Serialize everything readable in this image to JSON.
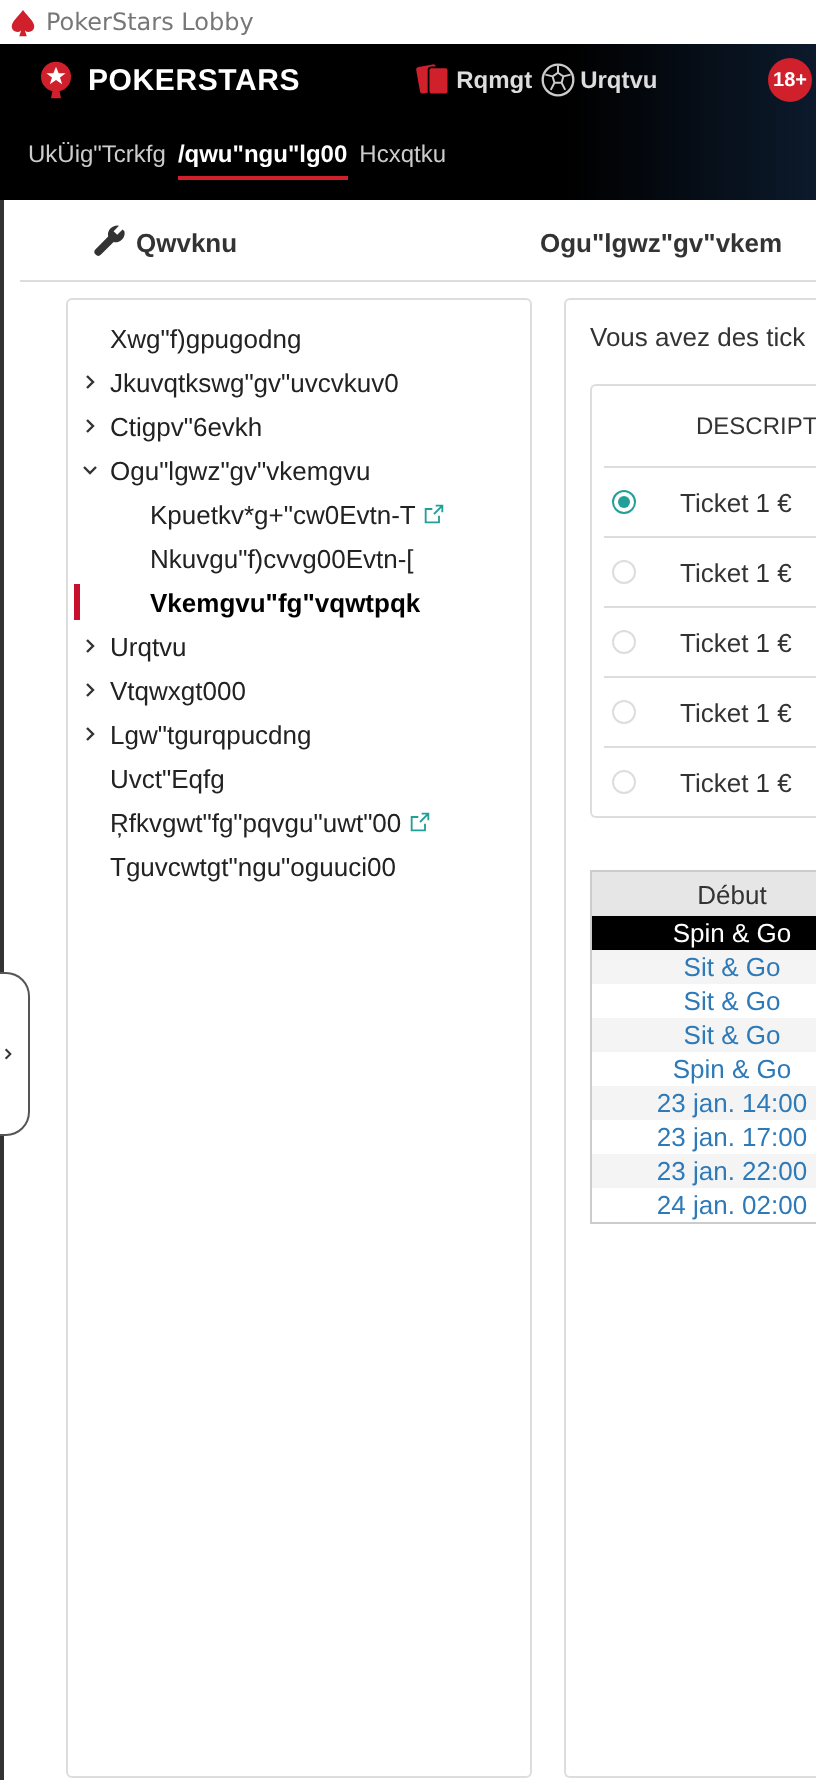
{
  "window": {
    "title": "PokerStars Lobby"
  },
  "header": {
    "brand": "POKERSTARS",
    "links": [
      {
        "label": "Rqmgt",
        "kind": "cards"
      },
      {
        "label": "Urqtvu",
        "kind": "ball"
      }
    ],
    "age_badge": "18+"
  },
  "nav": [
    {
      "label": "UkÜig\"Tcrkfg",
      "selected": false
    },
    {
      "label": "/qwu\"ngu\"lg00",
      "selected": true
    },
    {
      "label": "Hcxqtku",
      "selected": false
    }
  ],
  "sidebar": {
    "title": "Qwvknu",
    "items": [
      {
        "label": "Xwg\"f)gpugodng",
        "kind": "leaf",
        "selected": false,
        "external": false
      },
      {
        "label": "Jkuvqtkswg\"gv\"uvcvkuv0",
        "kind": "folder",
        "expanded": false,
        "selected": false,
        "external": false
      },
      {
        "label": "Ctigpv\"6evkh",
        "kind": "folder",
        "expanded": false,
        "selected": false,
        "external": false
      },
      {
        "label": "Ogu\"lgwz\"gv\"vkemgvu",
        "kind": "folder",
        "expanded": true,
        "selected": false,
        "external": false,
        "children": [
          {
            "label": "Kpuetkv*g+\"cw0Evtn-T",
            "selected": false,
            "external": true
          },
          {
            "label": "Nkuvgu\"f)cvvg00Evtn-[",
            "selected": false,
            "external": false
          },
          {
            "label": "Vkemgvu\"fg\"vqwtpqk",
            "selected": true,
            "external": false
          }
        ]
      },
      {
        "label": "Urqtvu",
        "kind": "folder",
        "expanded": false,
        "selected": false,
        "external": false
      },
      {
        "label": "Vtqwxgt000",
        "kind": "folder",
        "expanded": false,
        "selected": false,
        "external": false
      },
      {
        "label": "Lgw\"tgurqpucdng",
        "kind": "folder",
        "expanded": false,
        "selected": false,
        "external": false
      },
      {
        "label": "Uvct\"Eqfg",
        "kind": "leaf",
        "selected": false,
        "external": false
      },
      {
        "label": "Ŗfkvgwt\"fg\"pqvgu\"uwt\"00",
        "kind": "leaf",
        "selected": false,
        "external": true
      },
      {
        "label": "Tguvcwtgt\"ngu\"oguuci00",
        "kind": "leaf",
        "selected": false,
        "external": false
      }
    ]
  },
  "main": {
    "title": "Ogu\"lgwz\"gv\"vkem",
    "intro": "Vous avez des tick",
    "tickets": {
      "column": "DESCRIPT",
      "rows": [
        {
          "description": "Ticket 1 €",
          "selected": true
        },
        {
          "description": "Ticket 1 €",
          "selected": false
        },
        {
          "description": "Ticket 1 €",
          "selected": false
        },
        {
          "description": "Ticket 1 €",
          "selected": false
        },
        {
          "description": "Ticket 1 €",
          "selected": false
        }
      ]
    },
    "games": {
      "column": "Début",
      "rows": [
        {
          "start": "Spin & Go",
          "selected": true
        },
        {
          "start": "Sit & Go",
          "selected": false
        },
        {
          "start": "Sit & Go",
          "selected": false
        },
        {
          "start": "Sit & Go",
          "selected": false
        },
        {
          "start": "Spin & Go",
          "selected": false
        },
        {
          "start": "23 jan. 14:00",
          "selected": false
        },
        {
          "start": "23 jan. 17:00",
          "selected": false
        },
        {
          "start": "23 jan. 22:00",
          "selected": false
        },
        {
          "start": "24 jan. 02:00",
          "selected": false
        }
      ]
    }
  }
}
